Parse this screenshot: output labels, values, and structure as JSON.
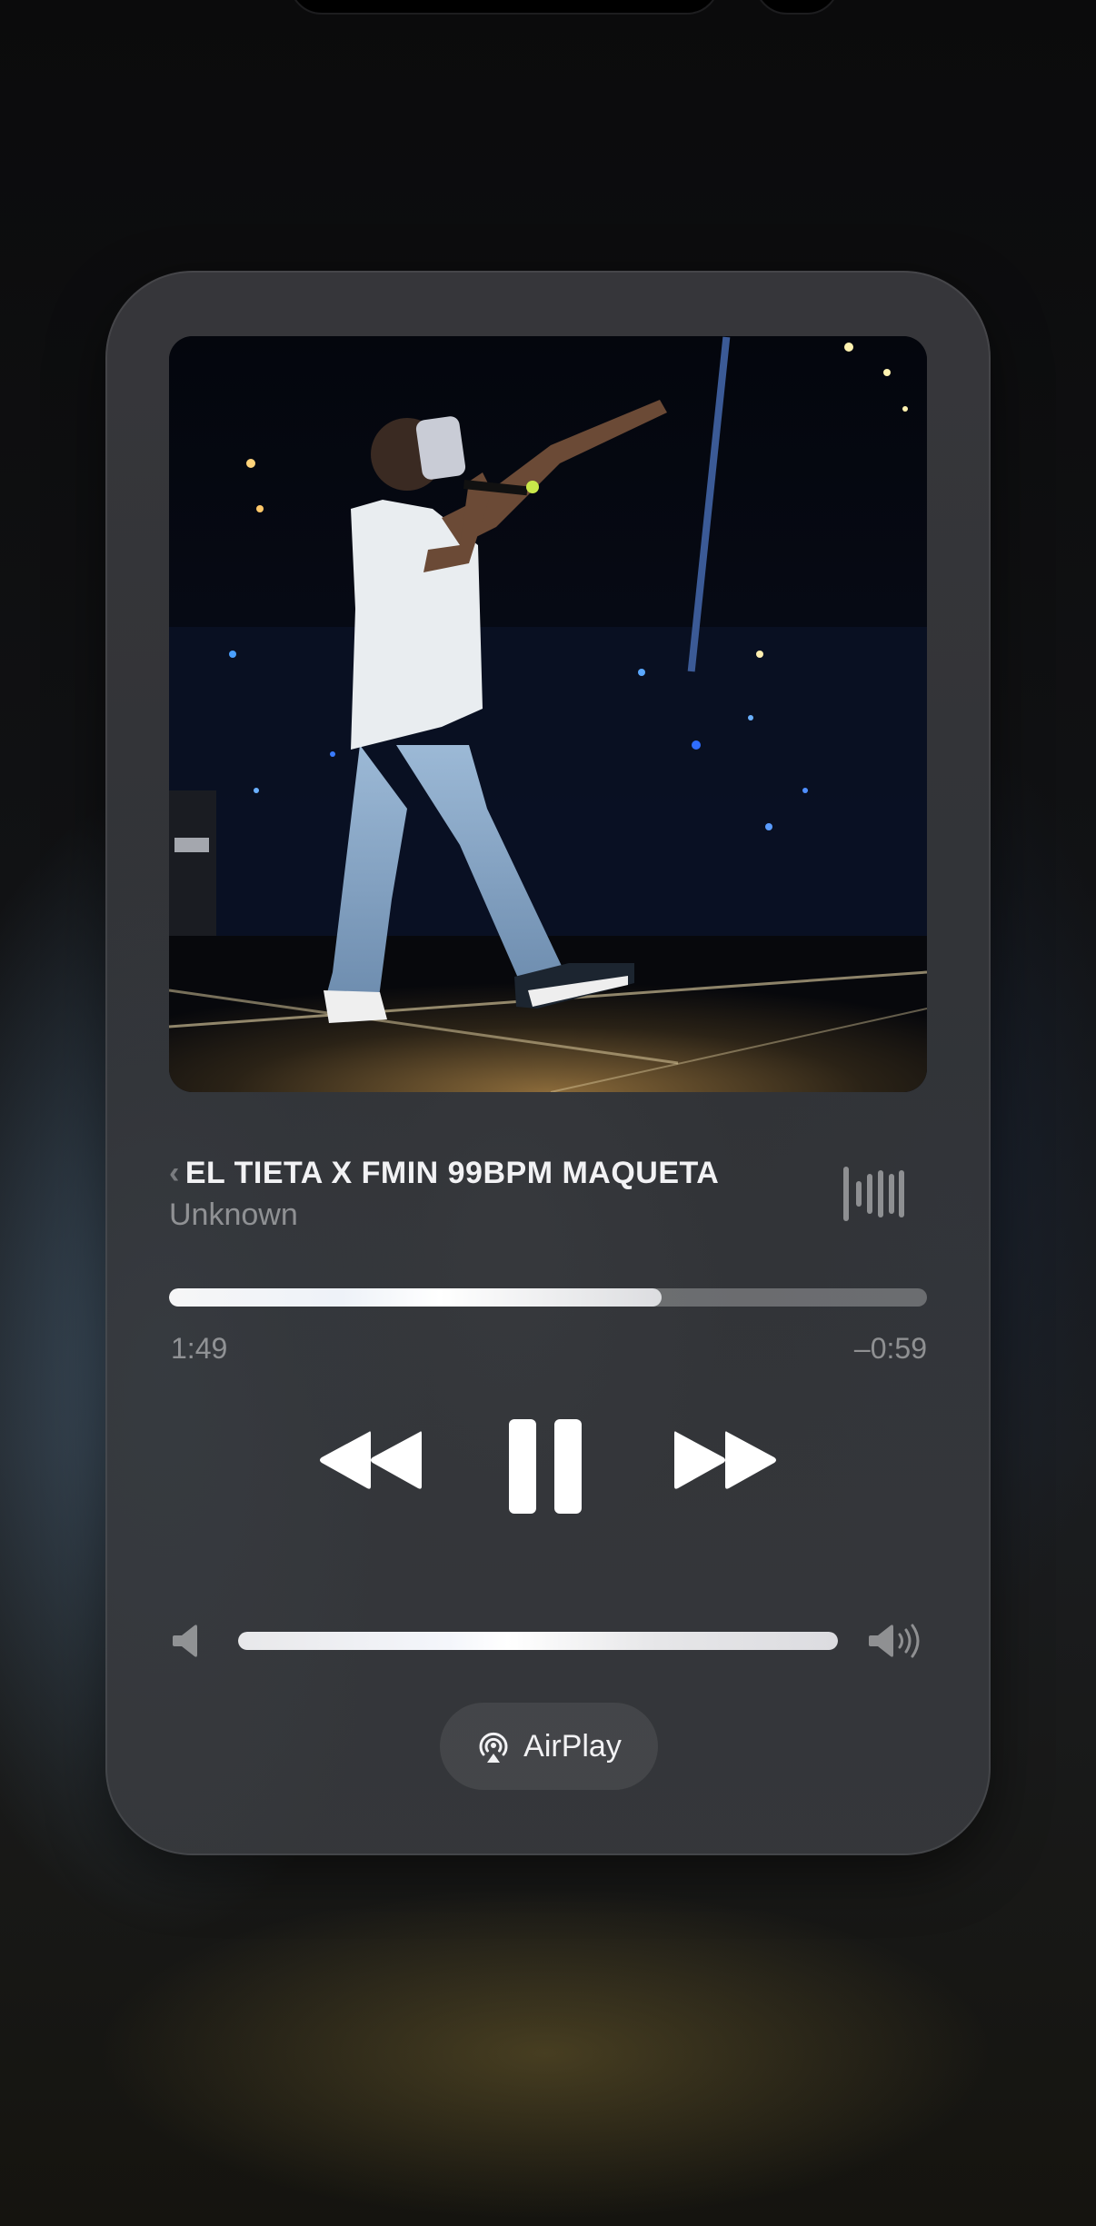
{
  "now_playing": {
    "title_prefix": "‹",
    "title": "EL TIETA X  FMIN 99BPM MAQUETA",
    "artist": "Unknown",
    "elapsed": "1:49",
    "remaining": "–0:59",
    "progress_fraction": 0.65,
    "is_playing": true
  },
  "volume": {
    "level_fraction": 1.0
  },
  "airplay": {
    "label": "AirPlay"
  },
  "colors": {
    "card_bg": "#3a3a3e",
    "text_primary": "#f2f2f4",
    "text_secondary": "#8e8e93"
  },
  "icons": {
    "rewind": "rewind-icon",
    "pause": "pause-icon",
    "forward": "fast-forward-icon",
    "waveform": "waveform-icon",
    "volume_low": "speaker-low-icon",
    "volume_high": "speaker-high-icon",
    "airplay": "airplay-icon"
  }
}
